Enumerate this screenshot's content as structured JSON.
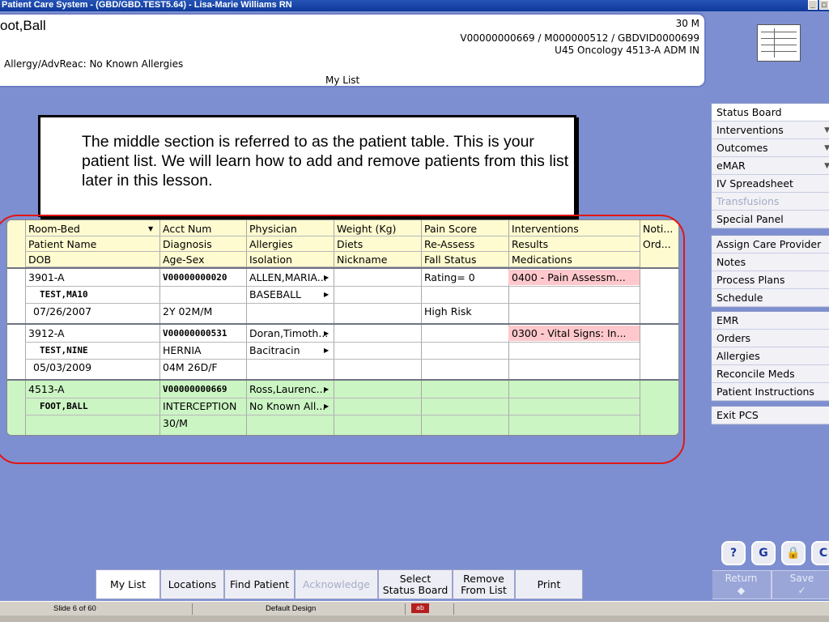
{
  "window": {
    "title": "Patient Care System - (GBD/GBD.TEST5.64) - Lisa-Marie Williams RN"
  },
  "banner": {
    "patient_name": "oot,Ball",
    "age_sex": "30 M",
    "visit_ids": "V00000000669 / M000000512 / GBDVID0000699",
    "location_line": "U45 Oncology  4513-A  ADM IN",
    "allergy_line": "Allergy/AdvReac: No Known Allergies",
    "list_title": "My List"
  },
  "callout": {
    "text": "The middle section is referred to as the patient table. This is your patient list. We will learn how to add and remove patients from this list later in this lesson."
  },
  "table": {
    "header_rows": [
      [
        "Room-Bed",
        "Acct Num",
        "Physician",
        "Weight (Kg)",
        "Pain Score",
        "Interventions",
        "Noti..."
      ],
      [
        "Patient Name",
        "Diagnosis",
        "Allergies",
        "Diets",
        "Re-Assess",
        "Results",
        "Ord..."
      ],
      [
        "DOB",
        "Age-Sex",
        "Isolation",
        "Nickname",
        "Fall Status",
        "Medications",
        ""
      ]
    ],
    "patients": [
      {
        "room": "3901-A",
        "acct": "V00000000020",
        "physician": "ALLEN,MARIA...",
        "pain": "Rating= 0",
        "interventions": "0400 - Pain Assessm...",
        "name": "TEST,MA10",
        "diagnosis": "",
        "allergies": "BASEBALL",
        "dob": "07/26/2007",
        "age_sex": "2Y 02M/M",
        "fall": "High Risk"
      },
      {
        "room": "3912-A",
        "acct": "V00000000531",
        "physician": "Doran,Timoth...",
        "pain": "",
        "interventions": "0300 - Vital Signs: In...",
        "name": "TEST,NINE",
        "diagnosis": "HERNIA",
        "allergies": "Bacitracin",
        "dob": "05/03/2009",
        "age_sex": "04M 26D/F",
        "fall": ""
      },
      {
        "room": "4513-A",
        "acct": "V00000000669",
        "physician": "Ross,Laurenc...",
        "pain": "",
        "interventions": "",
        "name": "FOOT,BALL",
        "diagnosis": "INTERCEPTION",
        "allergies": "No Known All...",
        "dob": "",
        "age_sex": "30/M",
        "fall": ""
      }
    ]
  },
  "right_menu": {
    "group1": [
      {
        "label": "Status Board"
      },
      {
        "label": "Interventions"
      },
      {
        "label": "Outcomes"
      },
      {
        "label": "eMAR"
      },
      {
        "label": "IV Spreadsheet"
      },
      {
        "label": "Transfusions"
      },
      {
        "label": "Special Panel"
      }
    ],
    "group2": [
      {
        "label": "Assign Care Provider"
      },
      {
        "label": "Notes"
      },
      {
        "label": "Process Plans"
      },
      {
        "label": "Schedule"
      }
    ],
    "group3": [
      {
        "label": "EMR"
      },
      {
        "label": "Orders"
      },
      {
        "label": "Allergies"
      },
      {
        "label": "Reconcile Meds"
      },
      {
        "label": "Patient Instructions"
      }
    ],
    "group4": [
      {
        "label": "Exit PCS"
      }
    ],
    "return_label": "Return",
    "save_label": "Save",
    "help_icons": [
      "?",
      "G",
      "🔒",
      "C"
    ]
  },
  "bottom_tabs": {
    "my_list": "My List",
    "locations": "Locations",
    "find_patient": "Find Patient",
    "acknowledge": "Acknowledge",
    "select_status_1": "Select",
    "select_status_2": "Status Board",
    "remove_1": "Remove",
    "remove_2": "From List",
    "print": "Print"
  },
  "status_bar": {
    "slide": "Slide 6 of 60",
    "design": "Default Design"
  },
  "colors": {
    "header_yellow": "#fffbd0",
    "pink": "#ffc8cc",
    "green": "#ccf5c4",
    "red_outline": "#e21616",
    "panel_blue": "#7d8fd0"
  }
}
